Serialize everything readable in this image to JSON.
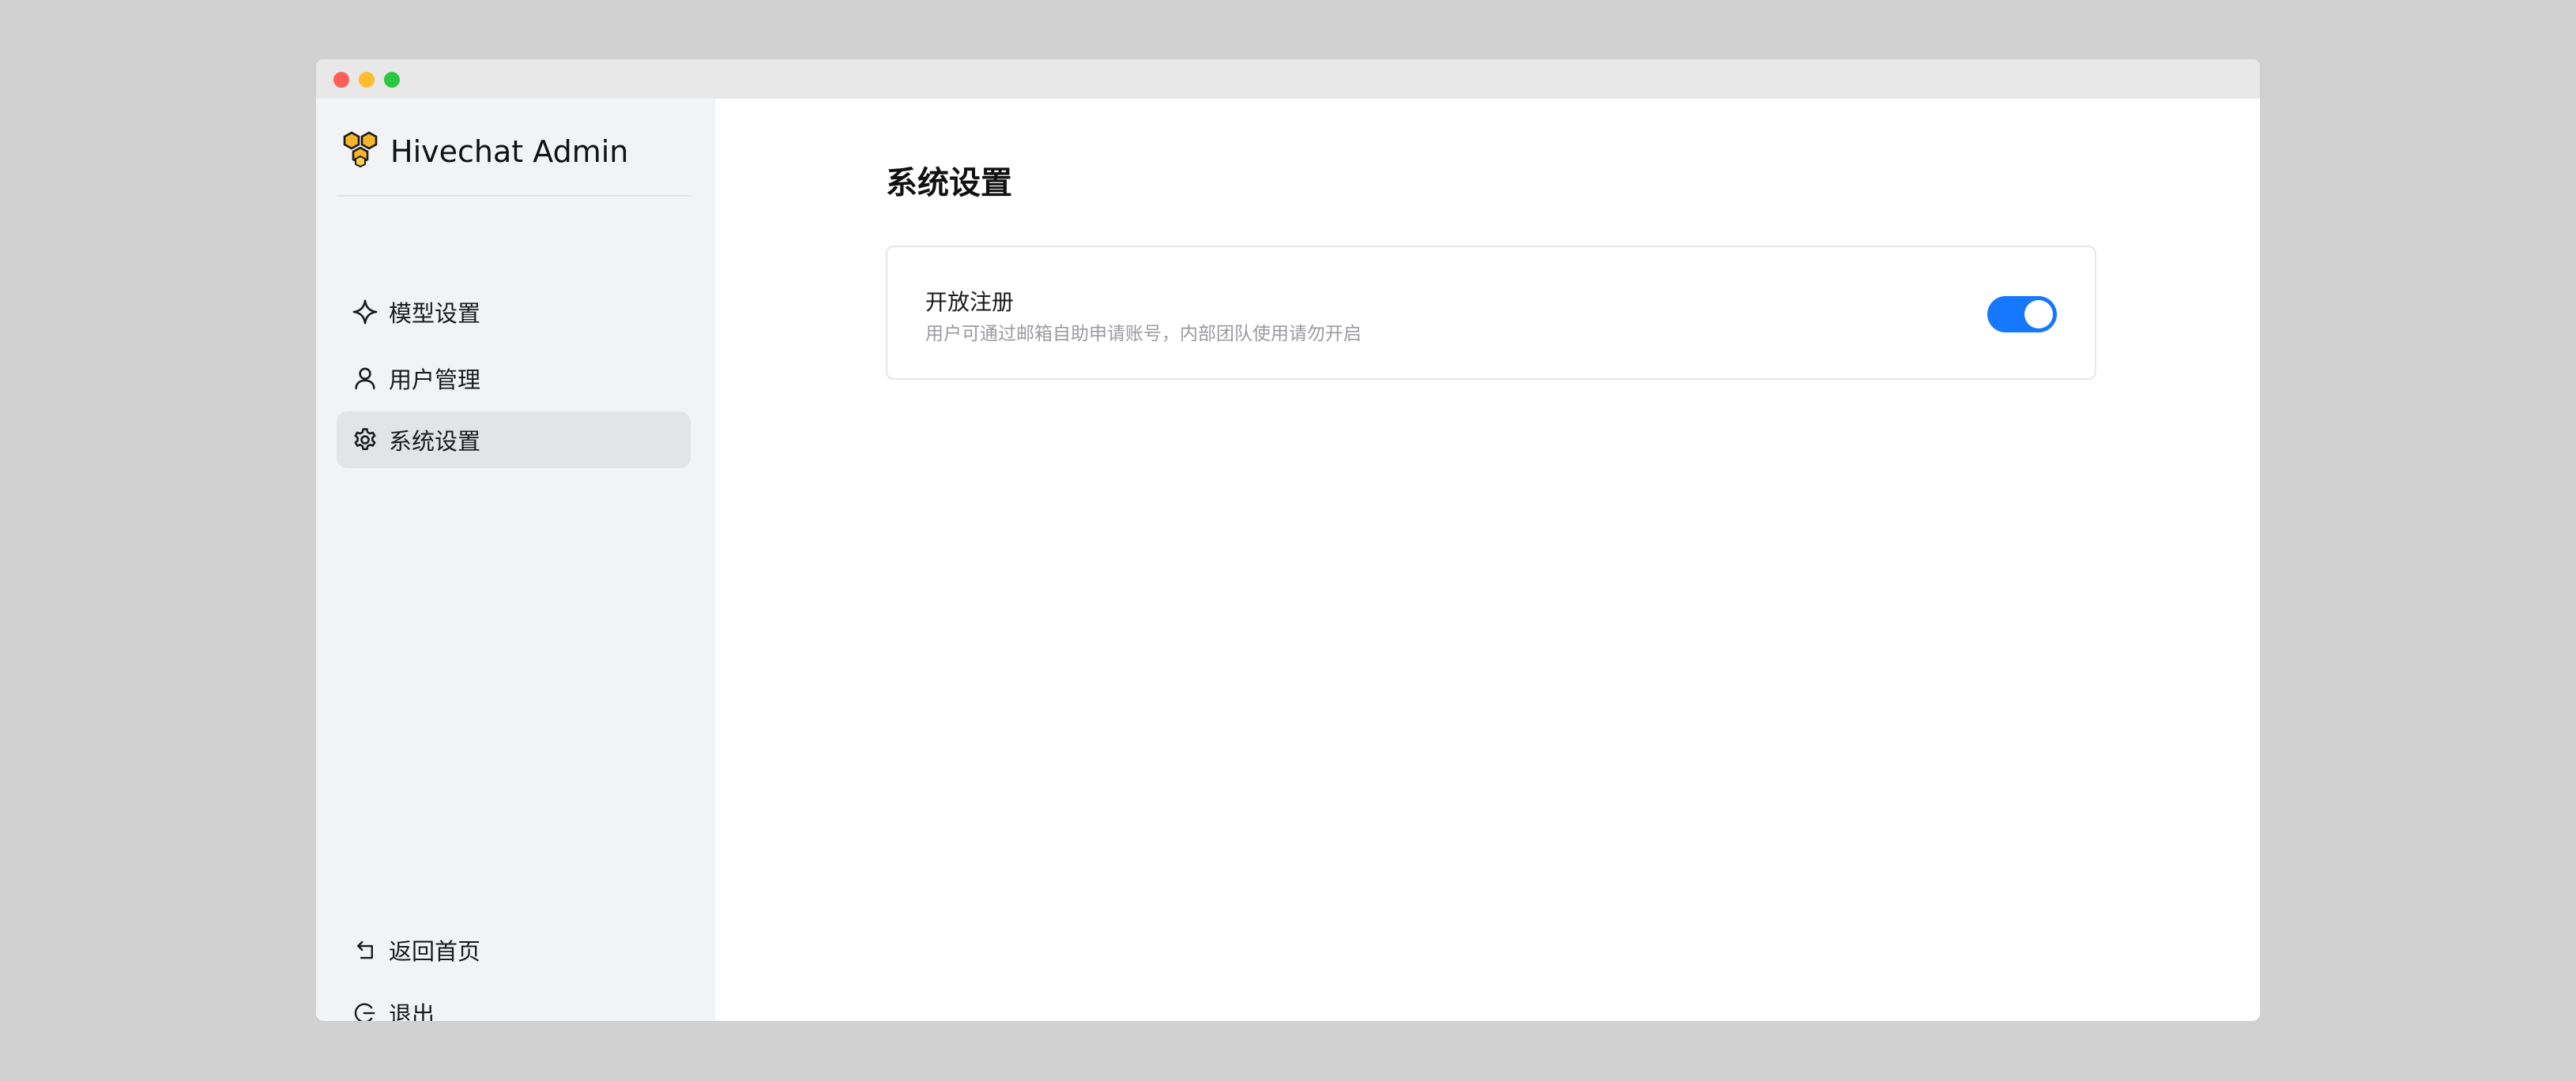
{
  "app": {
    "title": "Hivechat Admin",
    "logo_icon": "honeycomb-logo-icon",
    "accent_color": "#1677ff"
  },
  "sidebar": {
    "items": [
      {
        "label": "模型设置",
        "icon": "sparkle-icon",
        "active": false
      },
      {
        "label": "用户管理",
        "icon": "user-icon",
        "active": false
      },
      {
        "label": "系统设置",
        "icon": "gear-icon",
        "active": true
      }
    ],
    "bottom_items": [
      {
        "label": "返回首页",
        "icon": "return-icon"
      },
      {
        "label": "退出",
        "icon": "logout-icon"
      }
    ]
  },
  "main": {
    "page_title": "系统设置",
    "settings": [
      {
        "title": "开放注册",
        "description": "用户可通过邮箱自助申请账号，内部团队使用请勿开启",
        "enabled": true
      }
    ]
  }
}
